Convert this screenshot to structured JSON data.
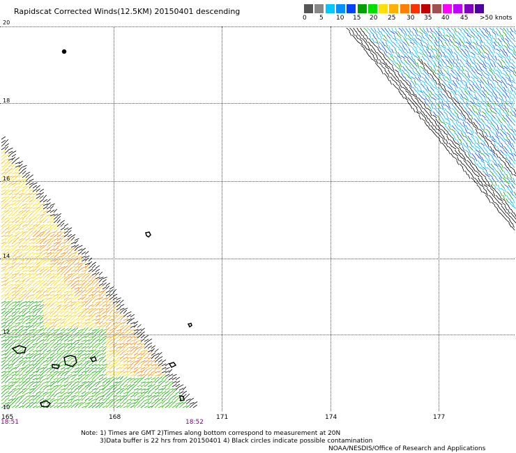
{
  "title": "Rapidscat Corrected Winds(12.5KM) 20150401 descending",
  "colorbar": {
    "labels": [
      "0",
      "5",
      "10",
      "15",
      "20",
      "25",
      "30",
      "35",
      "40",
      "45",
      ">50 knots"
    ],
    "colors": [
      "#555555",
      "#888888",
      "#00c8ff",
      "#0090ff",
      "#0040ff",
      "#00a000",
      "#00e000",
      "#ffe000",
      "#ffb000",
      "#ff8000",
      "#ff3000",
      "#c00000",
      "#a05050",
      "#ff00ff",
      "#c000ff",
      "#8000c0",
      "#5000a0"
    ]
  },
  "lat_labels": [
    "20",
    "18",
    "16",
    "14",
    "12",
    "10"
  ],
  "lon_labels": [
    "165",
    "168",
    "171",
    "174",
    "177"
  ],
  "time_labels": [
    "18:51",
    "18:52"
  ],
  "notes": {
    "line1": "Note: 1) Times are GMT 2)Times along bottom correspond to measurement at 20N",
    "line2": "3)Data buffer is 22 hrs from 20150401 4) Black circles indicate possible contamination",
    "line3": "NOAA/NESDIS/Office of Research and Applications"
  }
}
